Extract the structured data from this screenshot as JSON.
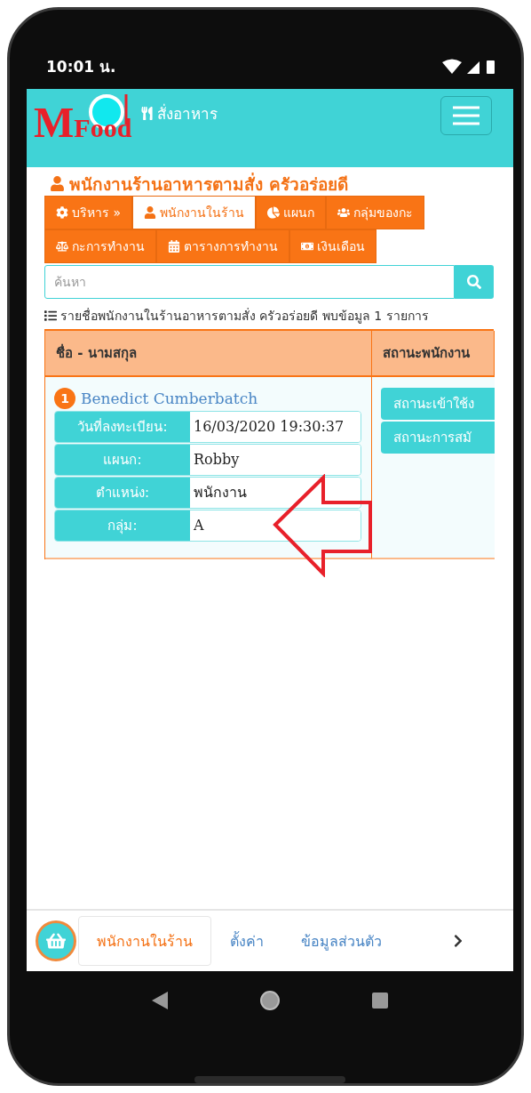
{
  "status_bar": {
    "time": "10:01 น."
  },
  "header": {
    "logo": {
      "initial": "M",
      "rest": "Food"
    },
    "brand": "สั่งอาหาร"
  },
  "page_title": "พนักงานร้านอาหารตามสั่ง ครัวอร่อยดี",
  "tabs": [
    {
      "label": "บริหาร »",
      "selected": false
    },
    {
      "label": "พนักงานในร้าน",
      "selected": true
    },
    {
      "label": "แผนก",
      "selected": false
    },
    {
      "label": "กลุ่มของกะ",
      "selected": false
    },
    {
      "label": "กะการทำงาน",
      "selected": false
    },
    {
      "label": "ตารางการทำงาน",
      "selected": false
    },
    {
      "label": "เงินเดือน",
      "selected": false
    }
  ],
  "search": {
    "placeholder": "ค้นหา"
  },
  "summary": "รายชื่อพนักงานในร้านอาหารตามสั่ง ครัวอร่อยดี พบข้อมูล 1 รายการ",
  "table": {
    "columns": [
      "ชื่อ - นามสกุล",
      "สถานะพนักงาน"
    ],
    "rows": [
      {
        "number": "1",
        "name": "Benedict Cumberbatch",
        "fields": [
          {
            "label": "วันที่ลงทะเบียน:",
            "value": "16/03/2020 19:30:37"
          },
          {
            "label": "แผนก:",
            "value": "Robby"
          },
          {
            "label": "ตำแหน่ง:",
            "value": "พนักงาน"
          },
          {
            "label": "กลุ่ม:",
            "value": "A"
          }
        ],
        "status_buttons": [
          "สถานะเข้าใช้ง",
          "สถานะการสมั"
        ]
      }
    ]
  },
  "bottom_tabs": [
    {
      "label": "พนักงานในร้าน",
      "selected": true
    },
    {
      "label": "ตั้งค่า",
      "selected": false
    },
    {
      "label": "ข้อมูลส่วนตัว",
      "selected": false
    }
  ]
}
